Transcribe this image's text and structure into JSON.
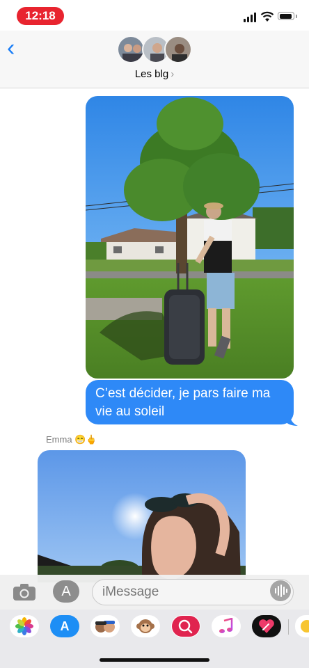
{
  "status_bar": {
    "time": "12:18"
  },
  "header": {
    "group_name": "Les blg",
    "chevron": "›",
    "back_icon": "‹"
  },
  "messages": {
    "sent_text": "C’est décider, je pars faire ma vie au soleil",
    "received_sender": "Emma",
    "received_sender_emoji": "😁🖕"
  },
  "input": {
    "placeholder": "iMessage",
    "appstore_glyph": "A"
  },
  "apps": {
    "items": [
      {
        "name": "photos",
        "glyph": "✿"
      },
      {
        "name": "app-store",
        "glyph": "A"
      },
      {
        "name": "memoji",
        "glyph": "☺"
      },
      {
        "name": "animoji",
        "glyph": "🐵"
      },
      {
        "name": "image-search",
        "glyph": "⊕"
      },
      {
        "name": "music",
        "glyph": "♫"
      },
      {
        "name": "digital-touch",
        "glyph": "❤"
      },
      {
        "name": "emoji",
        "glyph": "☻"
      }
    ]
  },
  "colors": {
    "accent": "#2e89f7",
    "status_pill": "#e8242f"
  }
}
